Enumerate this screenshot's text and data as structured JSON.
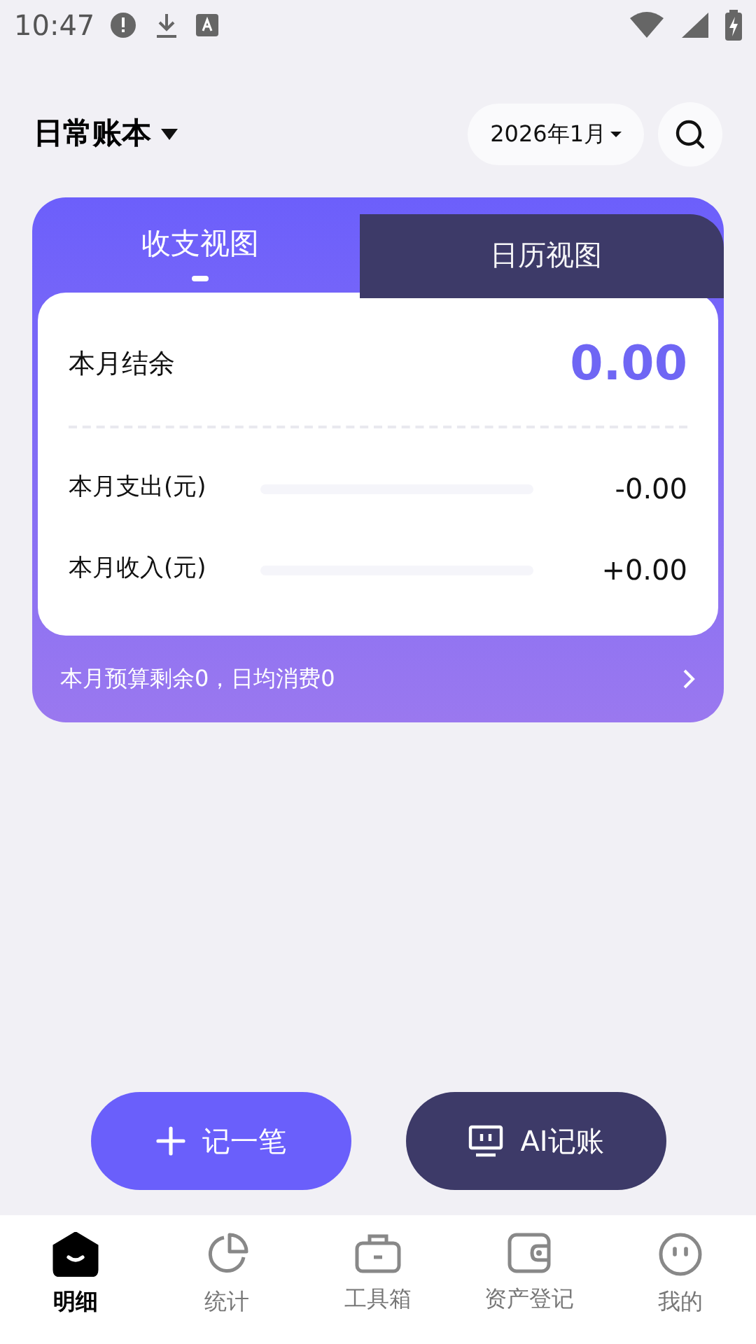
{
  "status_bar": {
    "time": "10:47"
  },
  "header": {
    "book": "日常账本",
    "month": "2026年1月"
  },
  "view_tabs": [
    {
      "label": "收支视图",
      "selected": true
    },
    {
      "label": "日历视图",
      "selected": false
    }
  ],
  "summary": {
    "balance_label": "本月结余",
    "balance": "0.00",
    "rows": [
      {
        "label": "本月支出(元)",
        "level": 0,
        "value": "-0.00"
      },
      {
        "label": "本月收入(元)",
        "level": 0,
        "value": "+0.00"
      }
    ],
    "budget_note": "本月预算剩余0，日均消费0"
  },
  "actions": [
    {
      "kind": "add",
      "label": "记一笔"
    },
    {
      "kind": "ai",
      "label": "AI记账"
    }
  ],
  "nav": [
    {
      "kind": "detail",
      "label": "明细",
      "selected": true
    },
    {
      "kind": "stats",
      "label": "统计",
      "selected": false
    },
    {
      "kind": "tools",
      "label": "工具箱",
      "selected": false
    },
    {
      "kind": "assets",
      "label": "资产登记",
      "selected": false
    },
    {
      "kind": "me",
      "label": "我的",
      "selected": false
    }
  ]
}
